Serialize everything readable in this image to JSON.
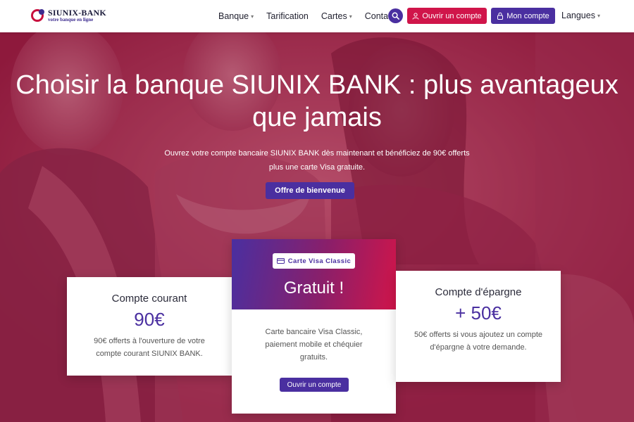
{
  "brand": {
    "name": "SIUNIX-BANK",
    "tagline": "votre banque en ligne"
  },
  "nav": {
    "items": [
      {
        "label": "Banque",
        "dropdown": true
      },
      {
        "label": "Tarification",
        "dropdown": false
      },
      {
        "label": "Cartes",
        "dropdown": true
      },
      {
        "label": "Contact",
        "dropdown": false
      }
    ],
    "open_account": "Ouvrir un compte",
    "my_account": "Mon compte",
    "languages": "Langues"
  },
  "hero": {
    "title": "Choisir la banque SIUNIX BANK : plus avantageux que jamais",
    "subtitle": "Ouvrez votre compte bancaire SIUNIX BANK dès maintenant et bénéficiez de 90€ offerts plus une carte Visa gratuite.",
    "cta": "Offre de bienvenue"
  },
  "cards": {
    "left": {
      "title": "Compte courant",
      "amount": "90€",
      "description": "90€ offerts à l'ouverture de votre compte courant SIUNIX BANK."
    },
    "center": {
      "badge": "Carte Visa Classic",
      "price": "Gratuit !",
      "description": "Carte bancaire Visa Classic, paiement mobile et chéquier gratuits.",
      "button": "Ouvrir un compte"
    },
    "right": {
      "title": "Compte d'épargne",
      "amount": "+ 50€",
      "description": "50€ offerts si vous ajoutez un compte d'épargne à votre demande."
    }
  },
  "colors": {
    "primary": "#4a2fa0",
    "accent": "#d0154a",
    "hero_tint": "#8f1f40"
  },
  "icons": {
    "search": "search-icon",
    "user": "user-icon",
    "lock": "lock-icon",
    "card": "credit-card-icon",
    "caret": "chevron-down-icon"
  }
}
